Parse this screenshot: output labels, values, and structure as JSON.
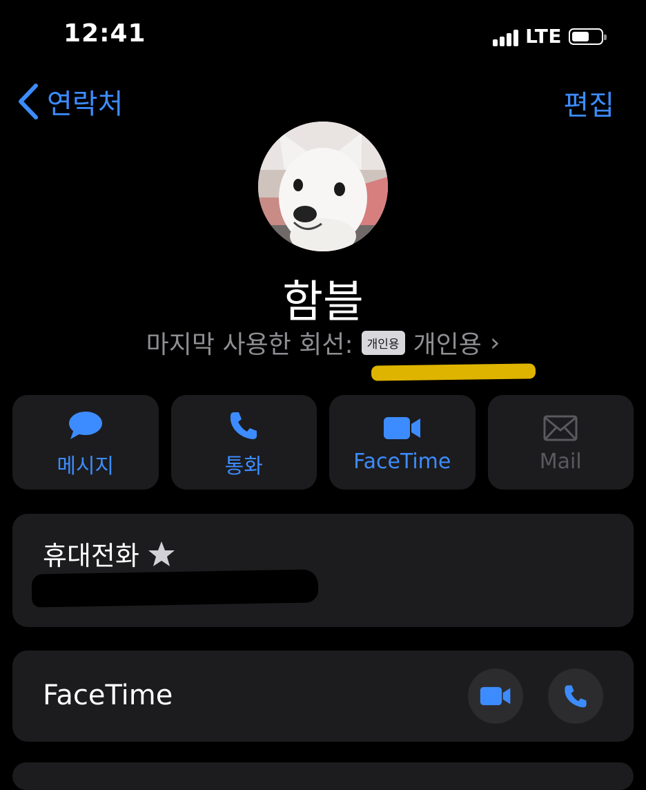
{
  "status_bar": {
    "time": "12:41",
    "network": "LTE"
  },
  "nav": {
    "back_label": "연락처",
    "edit_label": "편집"
  },
  "contact": {
    "name": "함블",
    "last_used_prefix": "마지막 사용한 회선:",
    "line_badge": "개인용",
    "line_name": "개인용"
  },
  "actions": [
    {
      "label": "메시지",
      "icon": "message-bubble-icon",
      "enabled": true
    },
    {
      "label": "통화",
      "icon": "phone-icon",
      "enabled": true
    },
    {
      "label": "FaceTime",
      "icon": "video-camera-icon",
      "enabled": true
    },
    {
      "label": "Mail",
      "icon": "envelope-icon",
      "enabled": false
    }
  ],
  "phone_card": {
    "label": "휴대전화"
  },
  "facetime_card": {
    "label": "FaceTime"
  },
  "colors": {
    "accent": "#3d8cff",
    "card": "#1c1c1e",
    "highlight": "#f2c300"
  }
}
